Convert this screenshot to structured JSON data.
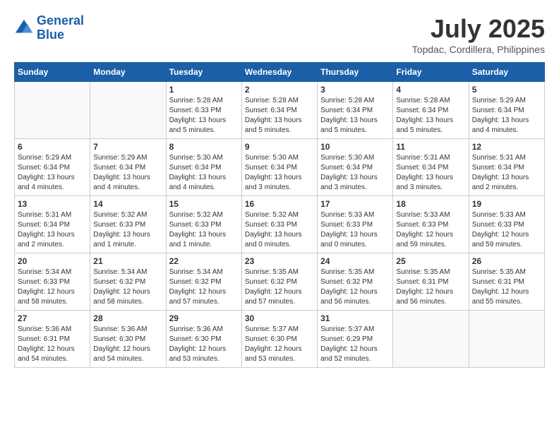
{
  "header": {
    "logo_line1": "General",
    "logo_line2": "Blue",
    "month_title": "July 2025",
    "location": "Topdac, Cordillera, Philippines"
  },
  "days_of_week": [
    "Sunday",
    "Monday",
    "Tuesday",
    "Wednesday",
    "Thursday",
    "Friday",
    "Saturday"
  ],
  "weeks": [
    [
      {
        "day": "",
        "info": ""
      },
      {
        "day": "",
        "info": ""
      },
      {
        "day": "1",
        "info": "Sunrise: 5:28 AM\nSunset: 6:33 PM\nDaylight: 13 hours\nand 5 minutes."
      },
      {
        "day": "2",
        "info": "Sunrise: 5:28 AM\nSunset: 6:34 PM\nDaylight: 13 hours\nand 5 minutes."
      },
      {
        "day": "3",
        "info": "Sunrise: 5:28 AM\nSunset: 6:34 PM\nDaylight: 13 hours\nand 5 minutes."
      },
      {
        "day": "4",
        "info": "Sunrise: 5:28 AM\nSunset: 6:34 PM\nDaylight: 13 hours\nand 5 minutes."
      },
      {
        "day": "5",
        "info": "Sunrise: 5:29 AM\nSunset: 6:34 PM\nDaylight: 13 hours\nand 4 minutes."
      }
    ],
    [
      {
        "day": "6",
        "info": "Sunrise: 5:29 AM\nSunset: 6:34 PM\nDaylight: 13 hours\nand 4 minutes."
      },
      {
        "day": "7",
        "info": "Sunrise: 5:29 AM\nSunset: 6:34 PM\nDaylight: 13 hours\nand 4 minutes."
      },
      {
        "day": "8",
        "info": "Sunrise: 5:30 AM\nSunset: 6:34 PM\nDaylight: 13 hours\nand 4 minutes."
      },
      {
        "day": "9",
        "info": "Sunrise: 5:30 AM\nSunset: 6:34 PM\nDaylight: 13 hours\nand 3 minutes."
      },
      {
        "day": "10",
        "info": "Sunrise: 5:30 AM\nSunset: 6:34 PM\nDaylight: 13 hours\nand 3 minutes."
      },
      {
        "day": "11",
        "info": "Sunrise: 5:31 AM\nSunset: 6:34 PM\nDaylight: 13 hours\nand 3 minutes."
      },
      {
        "day": "12",
        "info": "Sunrise: 5:31 AM\nSunset: 6:34 PM\nDaylight: 13 hours\nand 2 minutes."
      }
    ],
    [
      {
        "day": "13",
        "info": "Sunrise: 5:31 AM\nSunset: 6:34 PM\nDaylight: 13 hours\nand 2 minutes."
      },
      {
        "day": "14",
        "info": "Sunrise: 5:32 AM\nSunset: 6:33 PM\nDaylight: 13 hours\nand 1 minute."
      },
      {
        "day": "15",
        "info": "Sunrise: 5:32 AM\nSunset: 6:33 PM\nDaylight: 13 hours\nand 1 minute."
      },
      {
        "day": "16",
        "info": "Sunrise: 5:32 AM\nSunset: 6:33 PM\nDaylight: 13 hours\nand 0 minutes."
      },
      {
        "day": "17",
        "info": "Sunrise: 5:33 AM\nSunset: 6:33 PM\nDaylight: 13 hours\nand 0 minutes."
      },
      {
        "day": "18",
        "info": "Sunrise: 5:33 AM\nSunset: 6:33 PM\nDaylight: 12 hours\nand 59 minutes."
      },
      {
        "day": "19",
        "info": "Sunrise: 5:33 AM\nSunset: 6:33 PM\nDaylight: 12 hours\nand 59 minutes."
      }
    ],
    [
      {
        "day": "20",
        "info": "Sunrise: 5:34 AM\nSunset: 6:33 PM\nDaylight: 12 hours\nand 58 minutes."
      },
      {
        "day": "21",
        "info": "Sunrise: 5:34 AM\nSunset: 6:32 PM\nDaylight: 12 hours\nand 58 minutes."
      },
      {
        "day": "22",
        "info": "Sunrise: 5:34 AM\nSunset: 6:32 PM\nDaylight: 12 hours\nand 57 minutes."
      },
      {
        "day": "23",
        "info": "Sunrise: 5:35 AM\nSunset: 6:32 PM\nDaylight: 12 hours\nand 57 minutes."
      },
      {
        "day": "24",
        "info": "Sunrise: 5:35 AM\nSunset: 6:32 PM\nDaylight: 12 hours\nand 56 minutes."
      },
      {
        "day": "25",
        "info": "Sunrise: 5:35 AM\nSunset: 6:31 PM\nDaylight: 12 hours\nand 56 minutes."
      },
      {
        "day": "26",
        "info": "Sunrise: 5:35 AM\nSunset: 6:31 PM\nDaylight: 12 hours\nand 55 minutes."
      }
    ],
    [
      {
        "day": "27",
        "info": "Sunrise: 5:36 AM\nSunset: 6:31 PM\nDaylight: 12 hours\nand 54 minutes."
      },
      {
        "day": "28",
        "info": "Sunrise: 5:36 AM\nSunset: 6:30 PM\nDaylight: 12 hours\nand 54 minutes."
      },
      {
        "day": "29",
        "info": "Sunrise: 5:36 AM\nSunset: 6:30 PM\nDaylight: 12 hours\nand 53 minutes."
      },
      {
        "day": "30",
        "info": "Sunrise: 5:37 AM\nSunset: 6:30 PM\nDaylight: 12 hours\nand 53 minutes."
      },
      {
        "day": "31",
        "info": "Sunrise: 5:37 AM\nSunset: 6:29 PM\nDaylight: 12 hours\nand 52 minutes."
      },
      {
        "day": "",
        "info": ""
      },
      {
        "day": "",
        "info": ""
      }
    ]
  ]
}
